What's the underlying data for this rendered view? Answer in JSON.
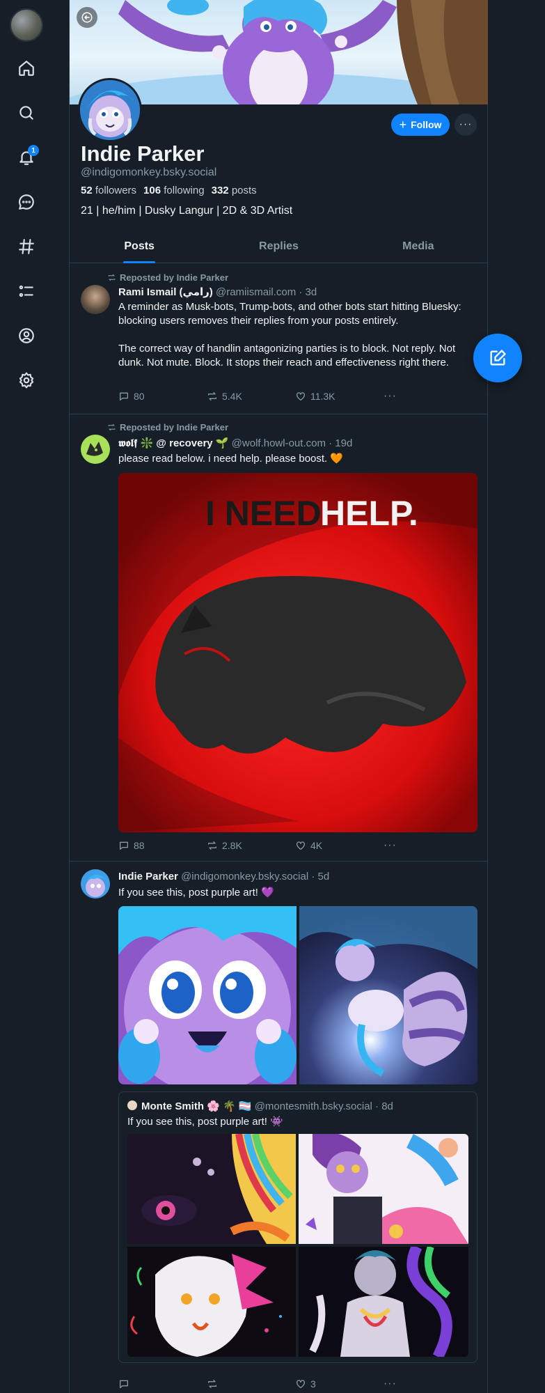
{
  "profile": {
    "display_name": "Indie Parker",
    "handle": "@indigomonkey.bsky.social",
    "followers_count": "52",
    "followers_label": "followers",
    "following_count": "106",
    "following_label": "following",
    "posts_count": "332",
    "posts_label": "posts",
    "bio": "21 | he/him | Dusky Langur | 2D & 3D Artist",
    "follow_label": "Follow",
    "more_label": "···"
  },
  "nav": {
    "notifications_badge": "1"
  },
  "tabs": [
    {
      "label": "Posts",
      "active": true
    },
    {
      "label": "Replies",
      "active": false
    },
    {
      "label": "Media",
      "active": false
    }
  ],
  "posts": [
    {
      "repost_label": "Reposted by Indie Parker",
      "author": "Rami Ismail (رامي)",
      "handle": "@ramiismail.com",
      "age": "· 3d",
      "text1": "A reminder as Musk-bots, Trump-bots, and other bots start hitting Bluesky: blocking users removes their replies from your posts entirely.",
      "text2": "The correct way of handlin antagonizing parties is to block. Not reply. Not dunk. Not mute. Block. It stops their reach and effectiveness right there.",
      "replies": "80",
      "reposts": "5.4K",
      "likes": "11.3K"
    },
    {
      "repost_label": "Reposted by Indie Parker",
      "author": "𝖜𝖔𝖑𝖋 ❇️ @ recovery 🌱",
      "handle": "@wolf.howl-out.com",
      "age": "· 19d",
      "text1": "please read below. i need help. please boost. 🧡",
      "image_text_1": "I NEED",
      "image_text_2": "HELP.",
      "replies": "88",
      "reposts": "2.8K",
      "likes": "4K"
    },
    {
      "author": "Indie Parker",
      "handle": "@indigomonkey.bsky.social",
      "age": "· 5d",
      "text1": "If you see this, post purple art! 💜",
      "quote_author": "Monte Smith 🌸 🌴 🏳️‍⚧️",
      "quote_handle": "@montesmith.bsky.social",
      "quote_age": "· 8d",
      "quote_text": "If you see this, post purple art! 👾",
      "replies": "",
      "reposts": "",
      "likes": "3"
    }
  ],
  "colors": {
    "background": "#161e27",
    "accent": "#1083fe",
    "muted": "#8c98a5",
    "border": "#2e3a46"
  }
}
